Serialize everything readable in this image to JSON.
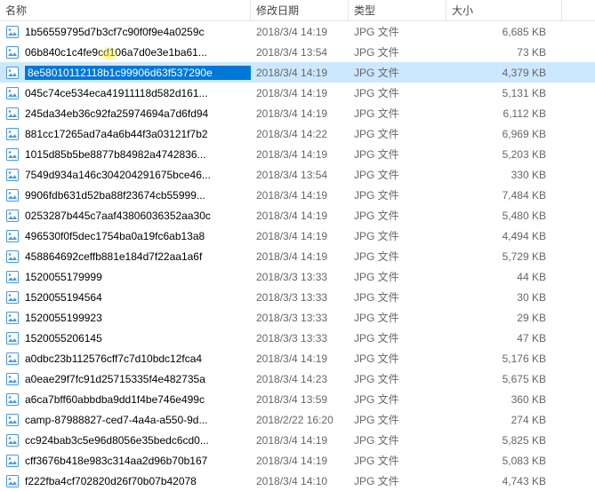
{
  "columns": {
    "name": "名称",
    "date": "修改日期",
    "type": "类型",
    "size": "大小"
  },
  "icon": "file-image-icon",
  "files": [
    {
      "name": "1b56559795d7b3cf7c90f0f9e4a0259c",
      "date": "2018/3/4 14:19",
      "type": "JPG 文件",
      "size": "6,685 KB",
      "selected": false
    },
    {
      "name": "06b840c1c4fe9cd106a7d0e3e1ba61...",
      "date": "2018/3/4 13:54",
      "type": "JPG 文件",
      "size": "73 KB",
      "selected": false
    },
    {
      "name": "8e58010112118b1c99906d63f537290e",
      "date": "2018/3/4 14:19",
      "type": "JPG 文件",
      "size": "4,379 KB",
      "selected": true
    },
    {
      "name": "045c74ce534eca41911118d582d161...",
      "date": "2018/3/4 14:19",
      "type": "JPG 文件",
      "size": "5,131 KB",
      "selected": false
    },
    {
      "name": "245da34eb36c92fa25974694a7d6fd94",
      "date": "2018/3/4 14:19",
      "type": "JPG 文件",
      "size": "6,112 KB",
      "selected": false
    },
    {
      "name": "881cc17265ad7a4a6b44f3a03121f7b2",
      "date": "2018/3/4 14:22",
      "type": "JPG 文件",
      "size": "6,969 KB",
      "selected": false
    },
    {
      "name": "1015d85b5be8877b84982a4742836...",
      "date": "2018/3/4 14:19",
      "type": "JPG 文件",
      "size": "5,203 KB",
      "selected": false
    },
    {
      "name": "7549d934a146c304204291675bce46...",
      "date": "2018/3/4 13:54",
      "type": "JPG 文件",
      "size": "330 KB",
      "selected": false
    },
    {
      "name": "9906fdb631d52ba88f23674cb55999...",
      "date": "2018/3/4 14:19",
      "type": "JPG 文件",
      "size": "7,484 KB",
      "selected": false
    },
    {
      "name": "0253287b445c7aaf43806036352aa30c",
      "date": "2018/3/4 14:19",
      "type": "JPG 文件",
      "size": "5,480 KB",
      "selected": false
    },
    {
      "name": "496530f0f5dec1754ba0a19fc6ab13a8",
      "date": "2018/3/4 14:19",
      "type": "JPG 文件",
      "size": "4,494 KB",
      "selected": false
    },
    {
      "name": "458864692ceffb881e184d7f22aa1a6f",
      "date": "2018/3/4 14:19",
      "type": "JPG 文件",
      "size": "5,729 KB",
      "selected": false
    },
    {
      "name": "1520055179999",
      "date": "2018/3/3 13:33",
      "type": "JPG 文件",
      "size": "44 KB",
      "selected": false
    },
    {
      "name": "1520055194564",
      "date": "2018/3/3 13:33",
      "type": "JPG 文件",
      "size": "30 KB",
      "selected": false
    },
    {
      "name": "1520055199923",
      "date": "2018/3/3 13:33",
      "type": "JPG 文件",
      "size": "29 KB",
      "selected": false
    },
    {
      "name": "1520055206145",
      "date": "2018/3/3 13:33",
      "type": "JPG 文件",
      "size": "47 KB",
      "selected": false
    },
    {
      "name": "a0dbc23b112576cff7c7d10bdc12fca4",
      "date": "2018/3/4 14:19",
      "type": "JPG 文件",
      "size": "5,176 KB",
      "selected": false
    },
    {
      "name": "a0eae29f7fc91d25715335f4e482735a",
      "date": "2018/3/4 14:23",
      "type": "JPG 文件",
      "size": "5,675 KB",
      "selected": false
    },
    {
      "name": "a6ca7bff60abbdba9dd1f4be746e499c",
      "date": "2018/3/4 13:59",
      "type": "JPG 文件",
      "size": "360 KB",
      "selected": false
    },
    {
      "name": "camp-87988827-ced7-4a4a-a550-9d...",
      "date": "2018/2/22 16:20",
      "type": "JPG 文件",
      "size": "274 KB",
      "selected": false
    },
    {
      "name": "cc924bab3c5e96d8056e35bedc6cd0...",
      "date": "2018/3/4 14:19",
      "type": "JPG 文件",
      "size": "5,825 KB",
      "selected": false
    },
    {
      "name": "cff3676b418e983c314aa2d96b70b167",
      "date": "2018/3/4 14:19",
      "type": "JPG 文件",
      "size": "5,083 KB",
      "selected": false
    },
    {
      "name": "f222fba4cf702820d26f70b07b42078",
      "date": "2018/3/4 14:10",
      "type": "JPG 文件",
      "size": "4,743 KB",
      "selected": false
    }
  ],
  "highlight": {
    "row": 1,
    "charOffset": 108
  }
}
